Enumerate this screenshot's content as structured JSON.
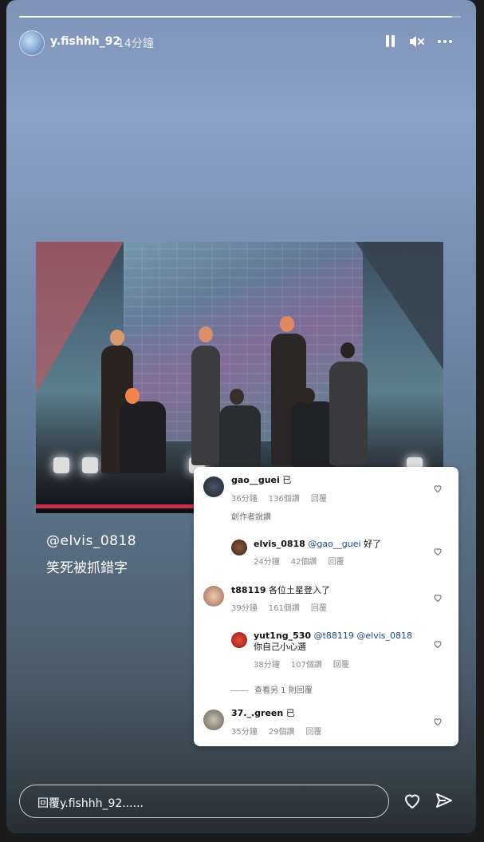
{
  "story": {
    "progress_fraction": 0.98,
    "username": "y.fishhh_92",
    "time_ago": "14分鐘",
    "icons": [
      "pause-icon",
      "mute-icon",
      "more-icon"
    ]
  },
  "caption": {
    "mention": "@elvis_0818",
    "text": "笑死被抓錯字"
  },
  "comments": {
    "items": [
      {
        "user": "gao__guei",
        "text": "已",
        "time": "36分鐘",
        "likes": "136個讚",
        "reply": "回覆",
        "badge": "創作者說讚"
      },
      {
        "user": "elvis_0818",
        "mention": "@gao__guei",
        "text": "好了",
        "time": "24分鐘",
        "likes": "42個讚",
        "reply": "回覆"
      },
      {
        "user": "t88119",
        "text": "各位土星登入了",
        "time": "39分鐘",
        "likes": "161個讚",
        "reply": "回覆"
      },
      {
        "user": "yut1ng_530",
        "mention": "@t88119 @elvis_0818",
        "text": "你自己小心選",
        "time": "38分鐘",
        "likes": "107個讚",
        "reply": "回覆"
      },
      {
        "user": "37._.green",
        "text": "已",
        "time": "35分鐘",
        "likes": "29個讚",
        "reply": "回覆"
      }
    ],
    "view_more": "查看另 1 則回覆"
  },
  "footer": {
    "reply_placeholder": "回覆y.fishhh_92......"
  }
}
